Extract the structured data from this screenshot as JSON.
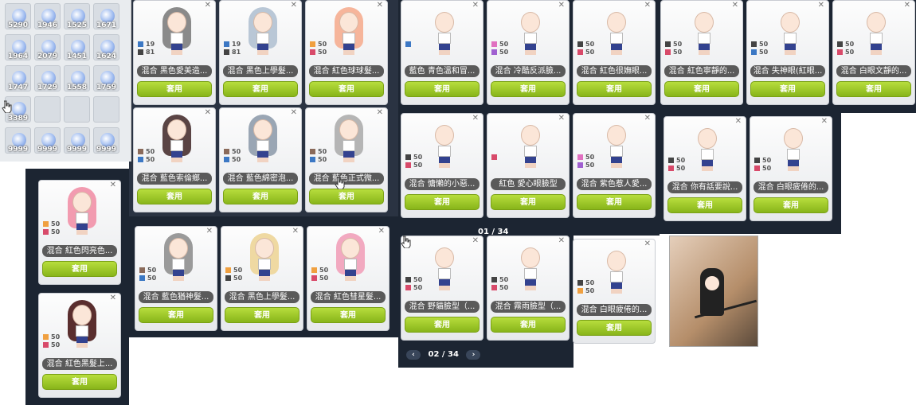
{
  "inventory": {
    "slots": [
      "5290",
      "1946",
      "1525",
      "1671",
      "1964",
      "2079",
      "1451",
      "1624",
      "1747",
      "1729",
      "1558",
      "1759",
      "3389",
      "",
      "",
      "",
      "9999",
      "9999",
      "9999",
      "9999"
    ]
  },
  "cards": [
    {
      "name": "混合 黑色愛美造...",
      "c1": "#3c78c4",
      "v1": "19",
      "c2": "#444",
      "v2": "81",
      "btn": "套用"
    },
    {
      "name": "混合 黑色上學髮...",
      "c1": "#3c78c4",
      "v1": "19",
      "c2": "#444",
      "v2": "81",
      "btn": "套用"
    },
    {
      "name": "混合 紅色球球髮...",
      "c1": "#f0a040",
      "v1": "50",
      "c2": "#d84a6a",
      "v2": "50",
      "btn": "套用"
    },
    {
      "name": "藍色 青色溫和冒...",
      "c1": "#3c78c4",
      "v1": "",
      "c2": "",
      "v2": "",
      "btn": "套用"
    },
    {
      "name": "混合 冷酷反派臉...",
      "c1": "#e070c0",
      "v1": "50",
      "c2": "#a060d0",
      "v2": "50",
      "btn": "套用"
    },
    {
      "name": "混合 紅色很嫵眼...",
      "c1": "#444",
      "v1": "50",
      "c2": "#d84a6a",
      "v2": "50",
      "btn": "套用"
    },
    {
      "name": "混合 紅色寧靜的...",
      "c1": "#444",
      "v1": "50",
      "c2": "#d84a6a",
      "v2": "50",
      "btn": "套用"
    },
    {
      "name": "混合 失神眼(紅眼...",
      "c1": "#444",
      "v1": "50",
      "c2": "#3c78c4",
      "v2": "50",
      "btn": "套用"
    },
    {
      "name": "混合 白眼文靜的...",
      "c1": "#444",
      "v1": "50",
      "c2": "#d84a6a",
      "v2": "50",
      "btn": "套用"
    },
    {
      "name": "混合 藍色索倫鄉...",
      "c1": "#8a6a5a",
      "v1": "50",
      "c2": "#3c78c4",
      "v2": "50",
      "btn": "套用"
    },
    {
      "name": "混合 藍色綿密泡...",
      "c1": "#8a6a5a",
      "v1": "50",
      "c2": "#3c78c4",
      "v2": "50",
      "btn": "套用"
    },
    {
      "name": "混合 藍色正式微...",
      "c1": "#8a6a5a",
      "v1": "50",
      "c2": "#3c78c4",
      "v2": "50",
      "btn": "套用"
    },
    {
      "name": "混合 慵懶的小惡...",
      "c1": "#444",
      "v1": "50",
      "c2": "#d84a6a",
      "v2": "50",
      "btn": "套用"
    },
    {
      "name": "紅色 愛心眼臉型",
      "c1": "#d84a6a",
      "v1": "",
      "c2": "",
      "v2": "",
      "btn": "套用"
    },
    {
      "name": "混合 紫色惹人愛...",
      "c1": "#e070c0",
      "v1": "50",
      "c2": "#a060d0",
      "v2": "50",
      "btn": "套用"
    },
    {
      "name": "混合 你有話要說...",
      "c1": "#444",
      "v1": "50",
      "c2": "#d84a6a",
      "v2": "50",
      "btn": "套用"
    },
    {
      "name": "混合 白眼疲倦的...",
      "c1": "#444",
      "v1": "50",
      "c2": "#d84a6a",
      "v2": "50",
      "btn": "套用"
    },
    {
      "name": "混合 紅色閃亮色...",
      "c1": "#f0a040",
      "v1": "50",
      "c2": "#d84a6a",
      "v2": "50",
      "btn": "套用"
    },
    {
      "name": "混合 藍色猶神髮...",
      "c1": "#8a6a5a",
      "v1": "50",
      "c2": "#3c78c4",
      "v2": "50",
      "btn": "套用"
    },
    {
      "name": "混合 黑色上學髮...",
      "c1": "#f0a040",
      "v1": "50",
      "c2": "#444",
      "v2": "50",
      "btn": "套用"
    },
    {
      "name": "混合 紅色彗星髮...",
      "c1": "#f0a040",
      "v1": "50",
      "c2": "#d84a6a",
      "v2": "50",
      "btn": "套用"
    },
    {
      "name": "混合 野貓臉型（...",
      "c1": "#444",
      "v1": "50",
      "c2": "#d84a6a",
      "v2": "50",
      "btn": "套用"
    },
    {
      "name": "混合 霧雨臉型（...",
      "c1": "#444",
      "v1": "50",
      "c2": "#d84a6a",
      "v2": "50",
      "btn": "套用"
    },
    {
      "name": "混合 白眼疲倦的...",
      "c1": "#444",
      "v1": "50",
      "c2": "#f0a040",
      "v2": "50",
      "btn": "套用"
    },
    {
      "name": "混合 紅色黑髮上...",
      "c1": "#f0a040",
      "v1": "50",
      "c2": "#d84a6a",
      "v2": "50",
      "btn": "套用"
    }
  ],
  "pager": {
    "page1": "01 / 34",
    "page2": "02 / 34",
    "prev": "‹",
    "next": "›"
  }
}
